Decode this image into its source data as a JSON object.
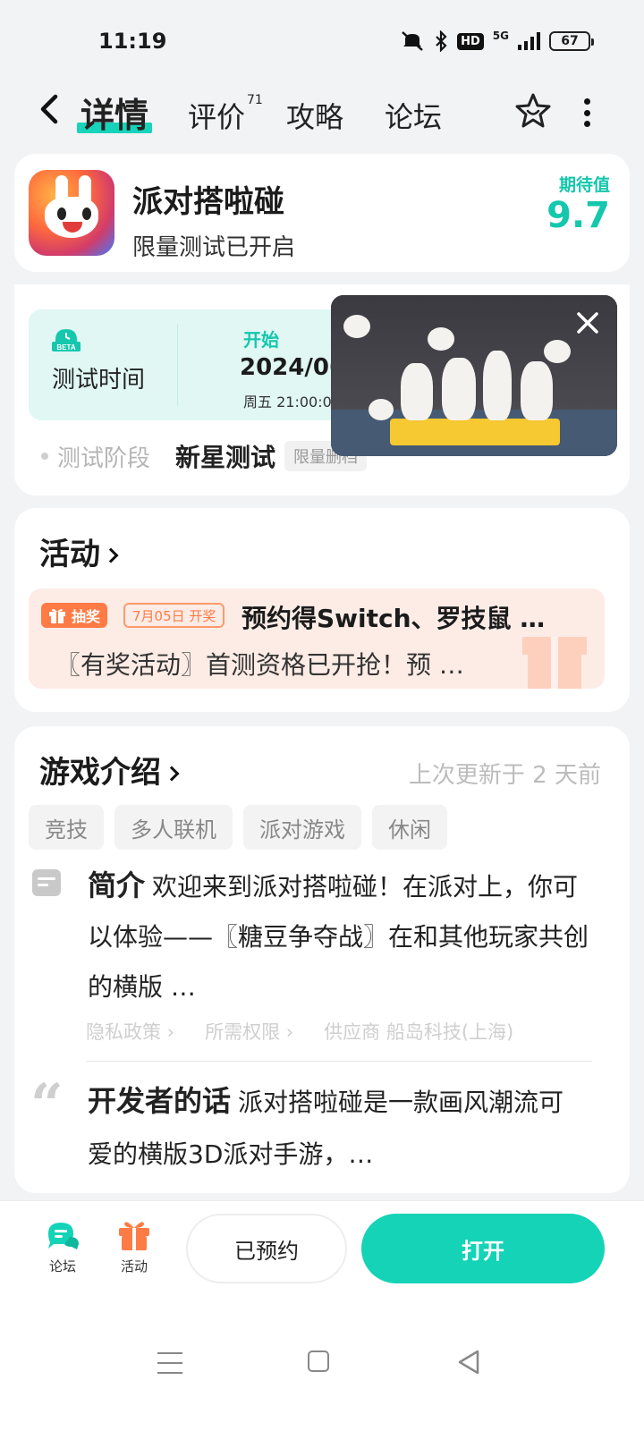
{
  "status_bar": {
    "time": "11:19",
    "network": "5G",
    "hd_label": "HD",
    "battery": "67"
  },
  "nav": {
    "tabs": [
      {
        "label": "详情",
        "active": true
      },
      {
        "label": "评价",
        "badge": "71"
      },
      {
        "label": "攻略"
      },
      {
        "label": "论坛"
      }
    ]
  },
  "app": {
    "name": "派对搭啦碰",
    "subtitle": "限量测试已开启",
    "expect_label": "期待值",
    "expect_value": "9.7"
  },
  "test": {
    "beta_label": "BETA",
    "time_label": "测试时间",
    "start_label": "开始",
    "start_date": "2024/06/2",
    "start_time": "周五 21:00:0",
    "stage_label": "测试阶段",
    "stage_value": "新星测试",
    "stage_tag": "限量删档"
  },
  "activity": {
    "title": "活动",
    "lottery_tag": "抽奖",
    "date_tag": "7月05日 开奖",
    "headline": "预约得Switch、罗技鼠 …",
    "description": "〖有奖活动〗首测资格已开抢！预 …"
  },
  "intro": {
    "title": "游戏介绍",
    "updated": "上次更新于 2 天前",
    "tags": [
      "竞技",
      "多人联机",
      "派对游戏",
      "休闲"
    ],
    "summary_label": "简介",
    "summary_text": "欢迎来到派对搭啦碰！在派对上，你可以体验——〖糖豆争夺战〗在和其他玩家共创的横版 …",
    "links": [
      "隐私政策 ›",
      "所需权限 ›",
      "供应商 船岛科技(上海)"
    ],
    "dev_label": "开发者的话",
    "dev_text": "派对搭啦碰是一款画风潮流可爱的横版3D派对手游，…"
  },
  "bottom_bar": {
    "forum_label": "论坛",
    "activity_label": "活动",
    "reserved_label": "已预约",
    "open_label": "打开"
  },
  "colors": {
    "accent": "#14d3b6",
    "accent_dark": "#14c7ad",
    "orange": "#ff7b45",
    "test_bg": "#e0f7f4",
    "activity_bg": "#fdece6"
  }
}
